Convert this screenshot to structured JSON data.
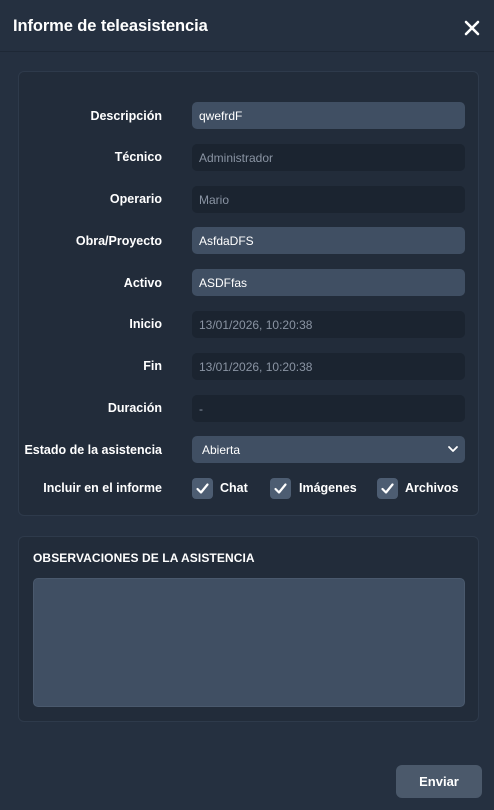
{
  "dialog": {
    "title": "Informe de teleasistencia",
    "close_icon": "close-icon"
  },
  "form": {
    "descripcion": {
      "label": "Descripción",
      "value": "qwefrdF"
    },
    "tecnico": {
      "label": "Técnico",
      "value": "Administrador"
    },
    "operario": {
      "label": "Operario",
      "value": "Mario"
    },
    "obra": {
      "label": "Obra/Proyecto",
      "value": "AsfdaDFS"
    },
    "activo": {
      "label": "Activo",
      "value": "ASDFfas"
    },
    "inicio": {
      "label": "Inicio",
      "value": "13/01/2026, 10:20:38"
    },
    "fin": {
      "label": "Fin",
      "value": "13/01/2026, 10:20:38"
    },
    "duracion": {
      "label": "Duración",
      "value": "-"
    },
    "estado": {
      "label": "Estado de la asistencia",
      "value": "Abierta"
    },
    "incluir": {
      "label": "Incluir en el informe",
      "options": [
        {
          "label": "Chat",
          "checked": true
        },
        {
          "label": "Imágenes",
          "checked": true
        },
        {
          "label": "Archivos",
          "checked": true
        }
      ]
    }
  },
  "observaciones": {
    "title": "OBSERVACIONES DE LA ASISTENCIA",
    "value": ""
  },
  "footer": {
    "send_label": "Enviar"
  },
  "colors": {
    "background": "#253040",
    "card": "#222c3a",
    "input_editable": "#404f63",
    "input_readonly": "#1b2430",
    "checkbox": "#4d5d72",
    "button": "#4b596b"
  }
}
